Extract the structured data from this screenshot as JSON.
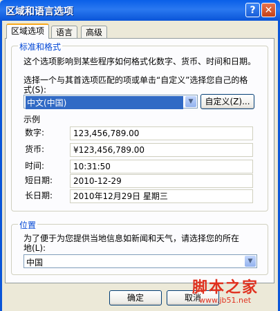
{
  "window": {
    "title": "区域和语言选项",
    "help_label": "?",
    "close_label": "✕"
  },
  "tabs": [
    {
      "label": "区域选项",
      "active": true
    },
    {
      "label": "语言",
      "active": false
    },
    {
      "label": "高级",
      "active": false
    }
  ],
  "standards": {
    "group_title": "标准和格式",
    "description": "这个选项影响到某些程序如何格式化数字、货币、时间和日期。",
    "select_prompt_line1": "选择一个与其首选项匹配的项或单击“自定义”选择您自己的格",
    "select_prompt_line2": "式(S):",
    "locale_value": "中文(中国)",
    "customize_label": "自定义(Z)...",
    "samples_title": "示例",
    "samples": [
      {
        "label": "数字:",
        "value": "123,456,789.00"
      },
      {
        "label": "货币:",
        "value": "¥123,456,789.00"
      },
      {
        "label": "时间:",
        "value": "10:31:50"
      },
      {
        "label": "短日期:",
        "value": "2010-12-29"
      },
      {
        "label": "长日期:",
        "value": "2010年12月29日 星期三"
      }
    ]
  },
  "location": {
    "group_title": "位置",
    "description_line1": "为了便于为您提供当地信息如新闻和天气，请选择您的所在",
    "description_line2": "地(L):",
    "value": "中国"
  },
  "buttons": {
    "ok": "确定",
    "cancel": "取消"
  },
  "watermark": {
    "text": "脚本之家",
    "url": "www.jb51.net"
  }
}
